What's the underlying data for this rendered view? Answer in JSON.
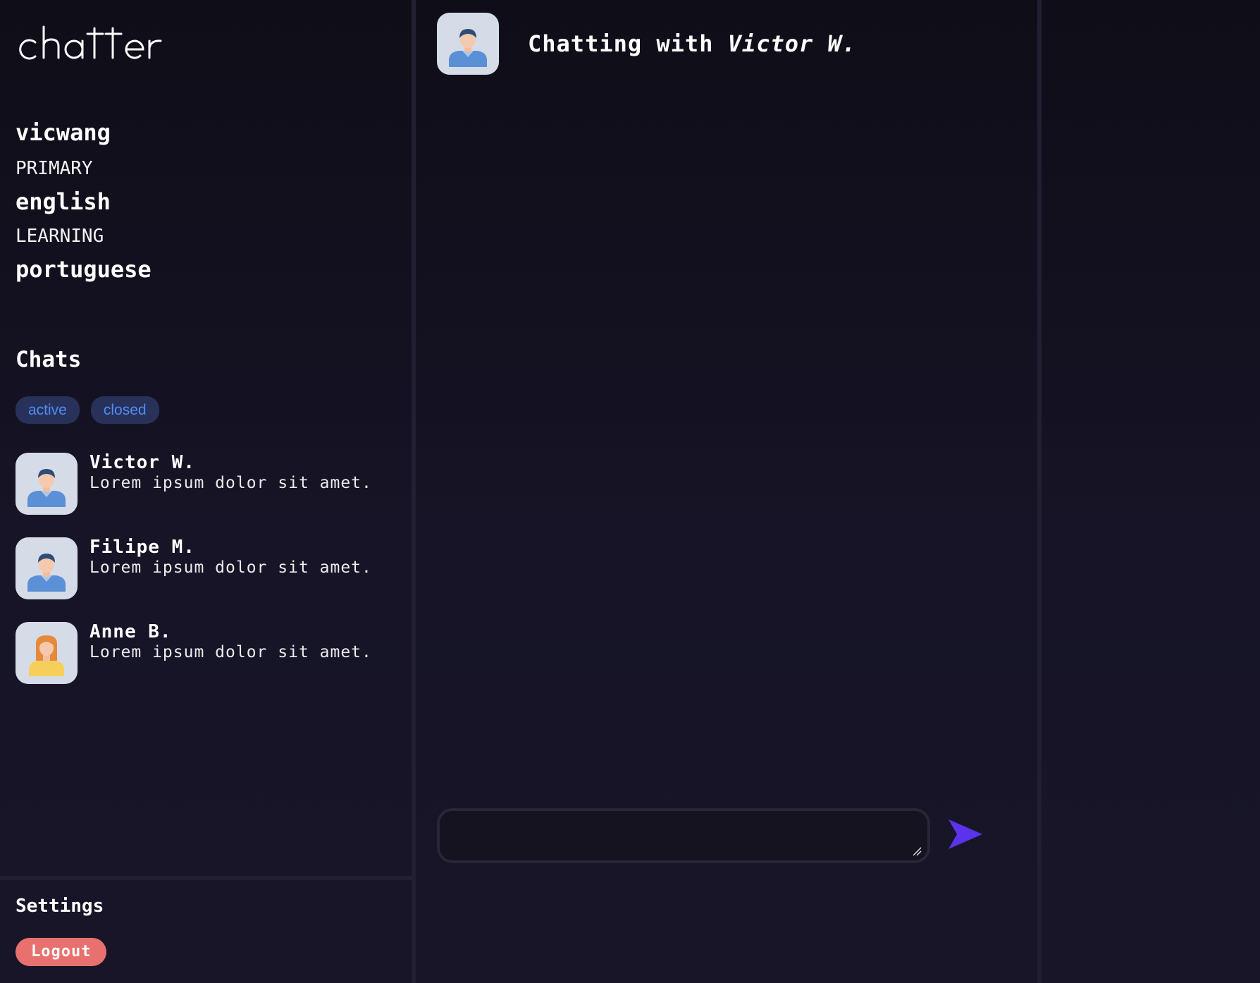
{
  "app": {
    "logo_text": "chatter"
  },
  "sidebar": {
    "username": "vicwang",
    "primary_label": "PRIMARY",
    "primary_language": "english",
    "learning_label": "LEARNING",
    "learning_language": "portuguese",
    "chats_heading": "Chats",
    "filters": [
      {
        "label": "active"
      },
      {
        "label": "closed"
      }
    ],
    "chats": [
      {
        "name": "Victor W.",
        "preview": "Lorem ipsum dolor sit amet.",
        "avatar": "male-avatar-icon"
      },
      {
        "name": "Filipe M.",
        "preview": "Lorem ipsum dolor sit amet.",
        "avatar": "male-avatar-icon"
      },
      {
        "name": "Anne B.",
        "preview": "Lorem ipsum dolor sit amet.",
        "avatar": "female-avatar-icon"
      }
    ],
    "settings_label": "Settings",
    "logout_label": "Logout"
  },
  "main": {
    "header_prefix": "Chatting with",
    "header_name": "Victor W.",
    "header_avatar": "male-avatar-icon",
    "message_placeholder": "",
    "send_icon": "send-arrow-icon"
  },
  "colors": {
    "background": "#15131f",
    "chip_bg": "#28315a",
    "chip_text": "#4f8df5",
    "logout_bg": "#e8716f",
    "send_accent": "#5b33ec",
    "avatar_bg": "#d5dce7"
  }
}
